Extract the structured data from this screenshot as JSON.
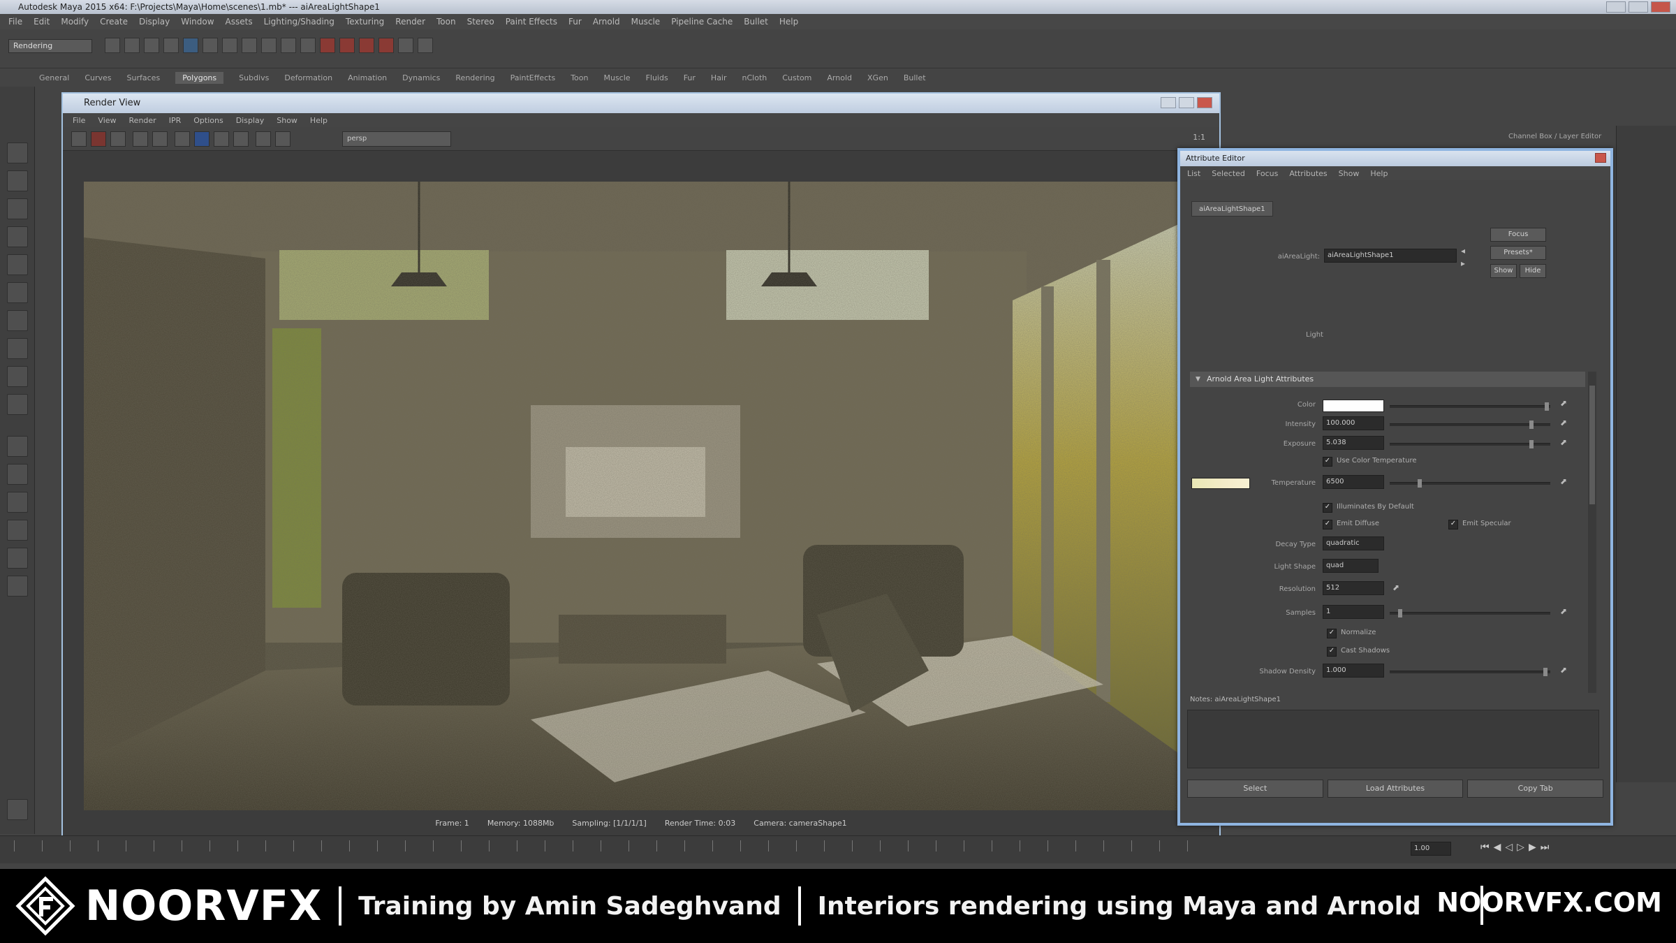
{
  "maya": {
    "title": "Autodesk Maya 2015 x64: F:\\Projects\\Maya\\Home\\scenes\\1.mb* --- aiAreaLightShape1",
    "menus": [
      "File",
      "Edit",
      "Modify",
      "Create",
      "Display",
      "Window",
      "Assets",
      "Lighting/Shading",
      "Texturing",
      "Render",
      "Toon",
      "Stereo",
      "Paint Effects",
      "Fur",
      "Arnold",
      "Muscle",
      "Pipeline Cache",
      "Bullet",
      "Help"
    ],
    "mode": "Rendering",
    "shelf_tabs": [
      "General",
      "Curves",
      "Surfaces",
      "Polygons",
      "Subdivs",
      "Deformation",
      "Animation",
      "Dynamics",
      "Rendering",
      "PaintEffects",
      "Toon",
      "Muscle",
      "Fluids",
      "Fur",
      "Hair",
      "nCloth",
      "Custom",
      "Arnold",
      "XGen",
      "Bullet"
    ],
    "active_shelf": "Polygons",
    "channel_box_label": "Channel Box / Layer Editor"
  },
  "render_view": {
    "title": "Render View",
    "menus": [
      "File",
      "View",
      "Render",
      "IPR",
      "Options",
      "Display",
      "Show",
      "Help"
    ],
    "camera": "persp",
    "zoom": "1:1",
    "status": {
      "frame": "Frame: 1",
      "memory": "Memory: 1088Mb",
      "sampling": "Sampling: [1/1/1/1]",
      "render_time": "Render Time: 0:03",
      "camera": "Camera: cameraShape1"
    }
  },
  "attribute_editor": {
    "title": "Attribute Editor",
    "menus": [
      "List",
      "Selected",
      "Focus",
      "Attributes",
      "Show",
      "Help"
    ],
    "tab": "aiAreaLightShape1",
    "node_label": "aiAreaLight:",
    "node_value": "aiAreaLightShape1",
    "buttons": {
      "focus": "Focus",
      "presets": "Presets*",
      "show": "Show",
      "hide": "Hide"
    },
    "light_label": "Light",
    "section": "Arnold Area Light Attributes",
    "attrs": {
      "color": "Color",
      "intensity_label": "Intensity",
      "intensity": "100.000",
      "exposure_label": "Exposure",
      "exposure": "5.038",
      "use_color_temperature": "Use Color Temperature",
      "temperature_label": "Temperature",
      "temperature": "6500",
      "illuminates_default": "Illuminates By Default",
      "emit_diffuse": "Emit Diffuse",
      "emit_specular": "Emit Specular",
      "decay_type_label": "Decay Type",
      "decay_type": "quadratic",
      "light_shape_label": "Light Shape",
      "light_shape": "quad",
      "resolution_label": "Resolution",
      "resolution": "512",
      "samples_label": "Samples",
      "samples": "1",
      "normalize": "Normalize",
      "cast_shadows": "Cast Shadows",
      "shadow_density_label": "Shadow Density",
      "shadow_density": "1.000"
    },
    "notes": "Notes: aiAreaLightShape1",
    "bottom_buttons": [
      "Select",
      "Load Attributes",
      "Copy Tab"
    ]
  },
  "timeline": {
    "current": "1.00"
  },
  "banner": {
    "brand": "NOORVFX",
    "training": "Training by Amin Sadeghvand",
    "course": "Interiors rendering using Maya and Arnold",
    "site": "NOORVFX.COM"
  }
}
